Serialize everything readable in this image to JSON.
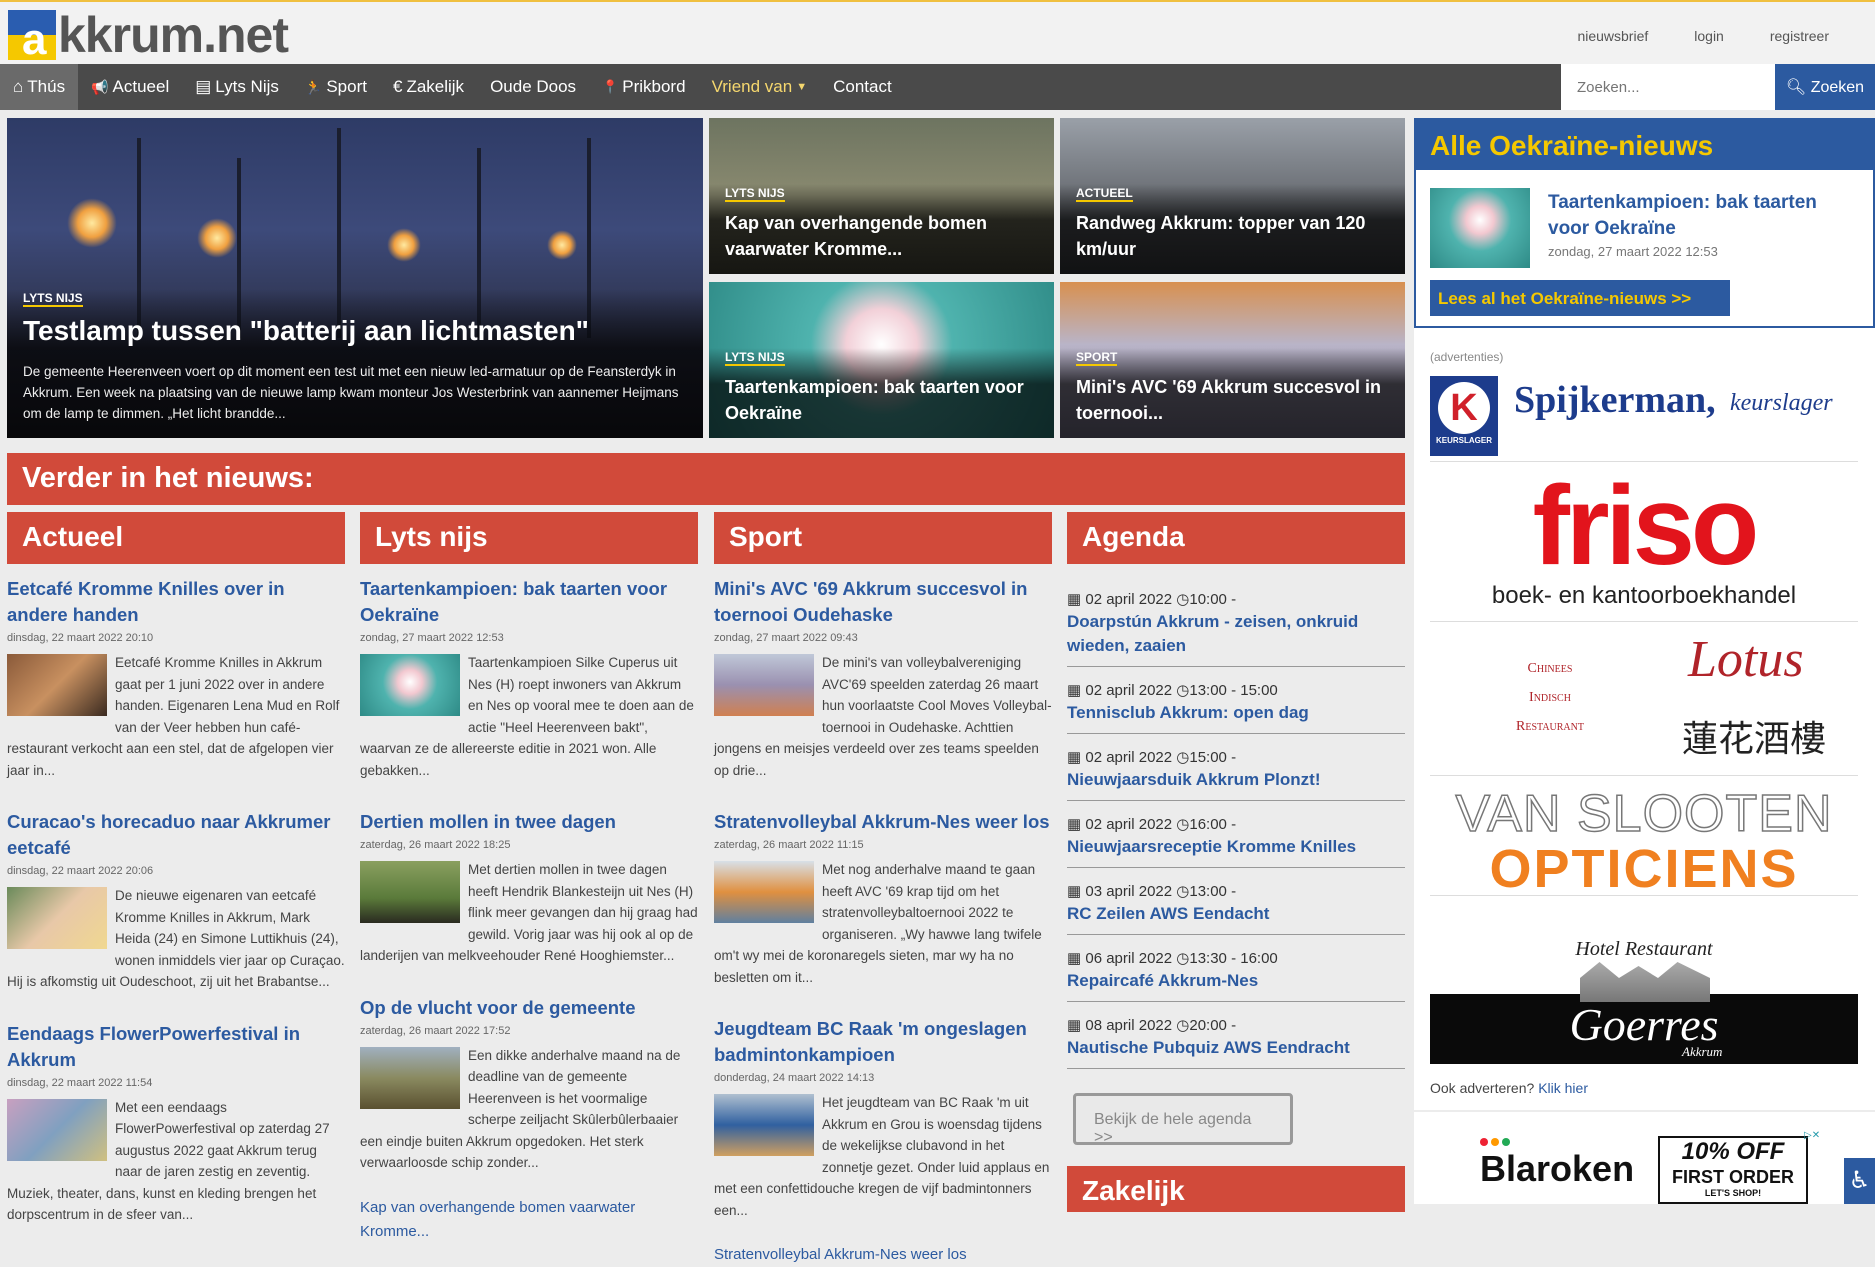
{
  "header": {
    "logo_a": "a",
    "logo_text": "kkrum.net",
    "toplinks": [
      "nieuwsbrief",
      "login",
      "registreer"
    ]
  },
  "nav": {
    "items": [
      {
        "icon": "home-icon",
        "glyph": "⌂",
        "label": "Thús"
      },
      {
        "icon": "megaphone-icon",
        "glyph": "📢",
        "label": "Actueel"
      },
      {
        "icon": "newspaper-icon",
        "glyph": "▤",
        "label": "Lyts Nijs"
      },
      {
        "icon": "runner-icon",
        "glyph": "🏃",
        "label": "Sport"
      },
      {
        "icon": "euro-icon",
        "glyph": "€",
        "label": "Zakelijk"
      },
      {
        "icon": "",
        "glyph": "",
        "label": "Oude Doos"
      },
      {
        "icon": "pin-icon",
        "glyph": "📍",
        "label": "Prikbord"
      },
      {
        "icon": "",
        "glyph": "",
        "label": "Vriend van"
      },
      {
        "icon": "",
        "glyph": "",
        "label": "Contact"
      }
    ],
    "search_placeholder": "Zoeken...",
    "search_button": "Zoeken"
  },
  "hero": {
    "category": "LYTS NIJS",
    "title": "Testlamp tussen \"batterij aan lichtmasten\"",
    "text": "De gemeente Heerenveen voert op dit moment een test uit met een nieuw led-armatuur op de Feansterdyk in Akkrum. Een week na plaatsing van de nieuwe lamp kwam monteur Jos Westerbrink van aannemer Heijmans om de lamp te dimmen. „Het licht brandde..."
  },
  "tiles": [
    {
      "category": "LYTS NIJS",
      "title": "Kap van overhangende bomen vaarwater Kromme..."
    },
    {
      "category": "ACTUEEL",
      "title": "Randweg Akkrum: topper van 120 km/uur"
    },
    {
      "category": "LYTS NIJS",
      "title": "Taartenkampioen: bak taarten voor Oekraïne"
    },
    {
      "category": "SPORT",
      "title": "Mini's AVC '69 Akkrum succesvol in toernooi..."
    }
  ],
  "sidebar": {
    "ukr_head": "Alle Oekraïne-nieuws",
    "ukr_title": "Taartenkampioen: bak taarten voor Oekraïne",
    "ukr_date": "zondag, 27 maart 2022 12:53",
    "ukr_button": "Lees al het Oekraïne-nieuws >>",
    "ads_label": "(advertenties)",
    "ad_spijkerman_k": "K",
    "ad_spijkerman_small": "KEURSLAGER",
    "ad_spijkerman": "Spijkerman,",
    "ad_spijkerman_sub": "keurslager",
    "ad_friso": "friso",
    "ad_friso_sub": "boek- en kantoorboekhandel",
    "ad_lotus_left": [
      "Chinees",
      "Indisch",
      "Restaurant"
    ],
    "ad_lotus": "Lotus",
    "ad_lotus_cn": "蓮花酒樓",
    "ad_vs1": "VAN SLOOTEN",
    "ad_vs2": "OPTICIENS",
    "ad_hotel": "Hotel Restaurant",
    "ad_goerres": "Goerres",
    "ad_goerres_sub": "Akkrum",
    "adverteren": "Ook adverteren?",
    "adverteren_link": "Klik hier",
    "blaroken": "Blaroken",
    "promo1": "10% OFF",
    "promo2": "FIRST ORDER",
    "promo3": "LET'S SHOP!"
  },
  "band": "Verder in het nieuws:",
  "columns": [
    {
      "head": "Actueel",
      "articles": [
        {
          "title": "Eetcafé Kromme Knilles over in andere handen",
          "date": "dinsdag, 22 maart 2022 20:10",
          "body": "Eetcafé Kromme Knilles in Akkrum gaat per 1 juni 2022 over in andere handen. Eigenaren Lena Mud en Rolf van der Veer hebben hun café-restaurant verkocht aan een stel, dat de afgelopen vier jaar in..."
        },
        {
          "title": "Curacao's horecaduo naar Akkrumer eetcafé",
          "date": "dinsdag, 22 maart 2022 20:06",
          "body": "De nieuwe eigenaren van eetcafé Kromme Knilles in Akkrum, Mark Heida (24) en Simone Luttikhuis (24), wonen inmiddels vier jaar op Curaçao. Hij is afkomstig uit Oudeschoot, zij uit het Brabantse..."
        },
        {
          "title": "Eendaags FlowerPowerfestival in Akkrum",
          "date": "dinsdag, 22 maart 2022 11:54",
          "body": "Met een eendaags FlowerPowerfestival op zaterdag 27 augustus 2022 gaat Akkrum terug naar de jaren zestig en zeventig. Muziek, theater, dans, kunst en kleding brengen het dorpscentrum in de sfeer van..."
        }
      ]
    },
    {
      "head": "Lyts nijs",
      "articles": [
        {
          "title": "Taartenkampioen: bak taarten voor Oekraïne",
          "date": "zondag, 27 maart 2022 12:53",
          "body": "Taartenkampioen Silke Cuperus uit Nes (H) roept inwoners van Akkrum en Nes op vooral mee te doen aan de actie \"Heel Heerenveen bakt\", waarvan ze de allereerste editie in 2021 won. Alle gebakken..."
        },
        {
          "title": "Dertien mollen in twee dagen",
          "date": "zaterdag, 26 maart 2022 18:25",
          "body": "Met dertien mollen in twee dagen heeft Hendrik Blankesteijn uit Nes (H) flink meer gevangen dan hij graag had gewild. Vorig jaar was hij ook al op de landerijen van melkveehouder René Hooghiemster..."
        },
        {
          "title": "Op de vlucht voor de gemeente",
          "date": "zaterdag, 26 maart 2022 17:52",
          "body": "Een dikke anderhalve maand na de deadline van de gemeente Heerenveen is het voormalige scherpe zeiljacht Skûlerbûlerbaaier een eindje buiten Akkrum opgedoken. Het sterk verwaarloosde schip zonder..."
        }
      ],
      "more": "Kap van overhangende bomen vaarwater Kromme..."
    },
    {
      "head": "Sport",
      "articles": [
        {
          "title": "Mini's AVC '69 Akkrum succesvol in toernooi Oudehaske",
          "date": "zondag, 27 maart 2022 09:43",
          "body": "De mini's van volleybalvereniging AVC'69 speelden zaterdag 26 maart hun voorlaatste Cool Moves Volleybal-toernooi in Oudehaske. Achttien jongens en meisjes verdeeld over zes teams speelden op drie..."
        },
        {
          "title": "Stratenvolleybal Akkrum-Nes weer los",
          "date": "zaterdag, 26 maart 2022 11:15",
          "body": "Met nog anderhalve maand te gaan heeft AVC '69 krap tijd om het stratenvolleybaltoernooi 2022 te organiseren. „Wy hawwe lang twifele om't wy mei de koronaregels sieten, mar wy ha no besletten om it..."
        },
        {
          "title": "Jeugdteam BC Raak 'm ongeslagen badmintonkampioen",
          "date": "donderdag, 24 maart 2022 14:13",
          "body": "Het jeugdteam van BC Raak 'm uit Akkrum en Grou is woensdag tijdens de wekelijkse clubavond in het zonnetje gezet. Onder luid applaus en met een confettidouche kregen de vijf badmintonners een..."
        }
      ],
      "more": "Stratenvolleybal Akkrum-Nes weer los"
    }
  ],
  "agenda": {
    "head": "Agenda",
    "items": [
      {
        "date": "02 april 2022",
        "time": "10:00 -",
        "title": "Doarpstún Akkrum - zeisen, onkruid wieden, zaaien"
      },
      {
        "date": "02 april 2022",
        "time": "13:00 - 15:00",
        "title": "Tennisclub Akkrum: open dag"
      },
      {
        "date": "02 april 2022",
        "time": "15:00 -",
        "title": "Nieuwjaarsduik Akkrum Plonzt!"
      },
      {
        "date": "02 april 2022",
        "time": "16:00 -",
        "title": "Nieuwjaarsreceptie Kromme Knilles"
      },
      {
        "date": "03 april 2022",
        "time": "13:00 -",
        "title": "RC Zeilen AWS Eendacht"
      },
      {
        "date": "06 april 2022",
        "time": "13:30 - 16:00",
        "title": "Repaircafé Akkrum-Nes"
      },
      {
        "date": "08 april 2022",
        "time": "20:00 -",
        "title": "Nautische Pubquiz AWS Eendracht"
      }
    ],
    "button": "Bekijk de hele agenda >>"
  },
  "zakelijk_head": "Zakelijk",
  "colors": {
    "brand_blue": "#2c5aa0",
    "brand_yellow": "#f5c800",
    "section_red": "#d14a3a",
    "nav_gray": "#4a4a4a"
  }
}
